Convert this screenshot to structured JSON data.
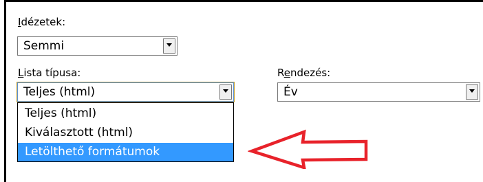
{
  "citations": {
    "label_first": "I",
    "label_rest": "dézetek:",
    "value": "Semmi"
  },
  "list_type": {
    "label_first": "L",
    "label_rest": "ista típusa:",
    "value": "Teljes (html)",
    "options": [
      "Teljes (html)",
      "Kiválasztott (html)",
      "Letölthető formátumok"
    ],
    "highlighted_option": "Letölthető formátumok"
  },
  "sort": {
    "label_start": "R",
    "label_underlined": "e",
    "label_rest": "ndezés:",
    "value": "Év"
  },
  "annotation": {
    "arrow_color": "#e8222a",
    "points_to": "Letölthető formátumok"
  },
  "colors": {
    "highlight": "#3399ff",
    "focus_border": "#c9a22b"
  }
}
